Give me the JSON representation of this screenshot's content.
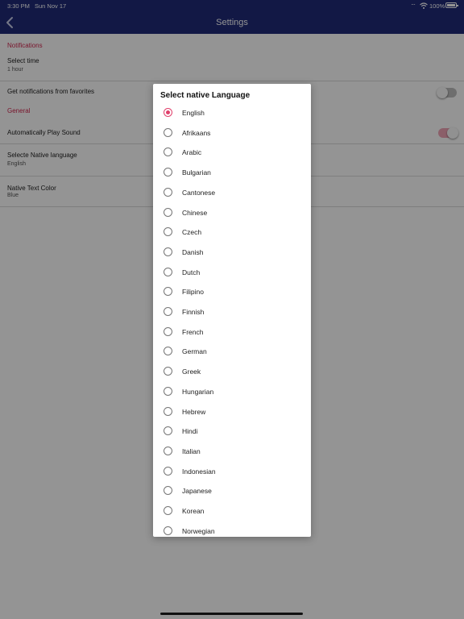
{
  "status_bar": {
    "time": "3:30 PM",
    "date": "Sun Nov 17",
    "dots": "···",
    "battery": "100%"
  },
  "nav": {
    "title": "Settings"
  },
  "settings": {
    "notifications_header": "Notifications",
    "select_time_label": "Select time",
    "select_time_value": "1 hour",
    "favorites_label": "Get notifications from favorites",
    "favorites_on": false,
    "general_header": "General",
    "auto_play_label": "Automatically Play Sound",
    "auto_play_on": true,
    "native_language_label": "Selecte Native language",
    "native_language_value": "English",
    "native_text_color_label": "Native Text Color",
    "native_text_color_value": "Blue"
  },
  "dialog": {
    "title": "Select native Language",
    "selected": "English",
    "options": [
      "English",
      "Afrikaans",
      "Arabic",
      "Bulgarian",
      "Cantonese",
      "Chinese",
      "Czech",
      "Danish",
      "Dutch",
      "Filipino",
      "Finnish",
      "French",
      "German",
      "Greek",
      "Hungarian",
      "Hebrew",
      "Hindi",
      "Italian",
      "Indonesian",
      "Japanese",
      "Korean",
      "Norwegian"
    ]
  },
  "colors": {
    "nav_bg": "#1f2a78",
    "accent": "#e0406b",
    "section_header": "#d1264f"
  }
}
